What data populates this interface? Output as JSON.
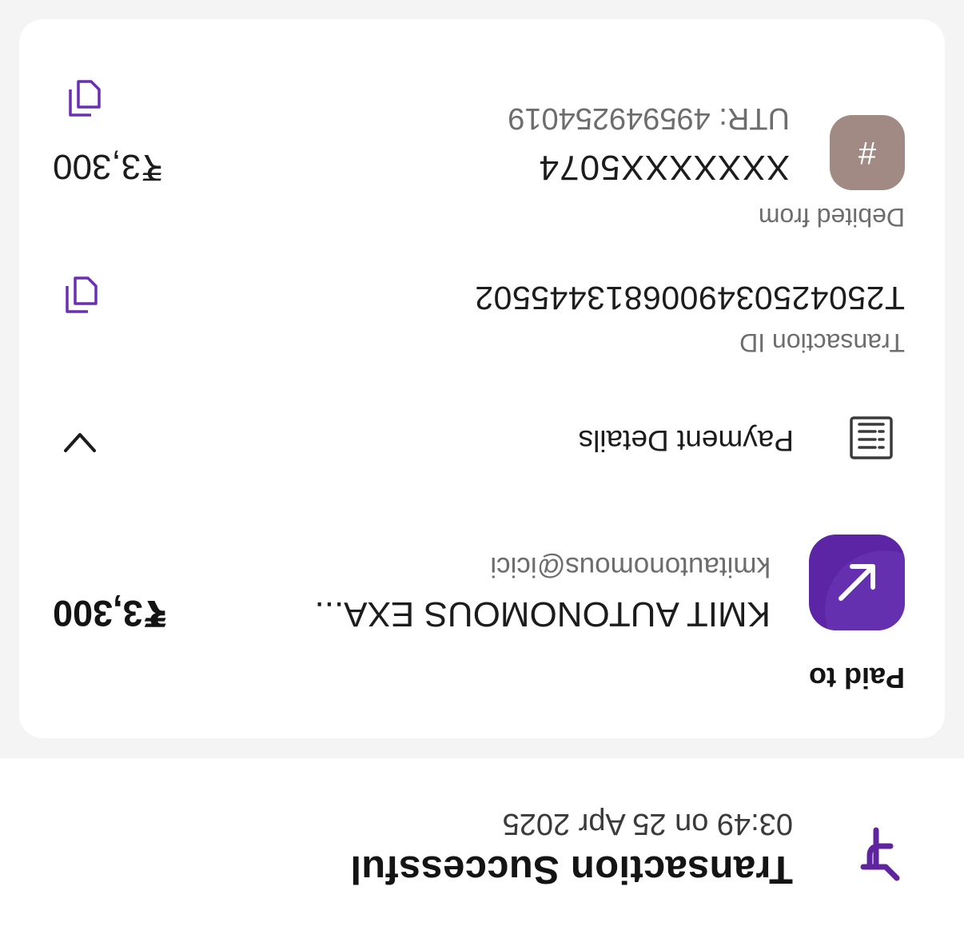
{
  "header": {
    "title": "Transaction Successful",
    "timestamp": "03:49 on 25 Apr 2025",
    "app_icon": "phonepe-logo-icon",
    "brand_color": "#5f259f"
  },
  "paid_to": {
    "label": "Paid to",
    "payee_name": "KMIT AUTONOMOUS EXA...",
    "payee_upi": "kmitautonomous@icici",
    "amount": "₹3,300",
    "avatar_icon": "arrow-down-left-icon"
  },
  "payment_details": {
    "label": "Payment Details",
    "icon": "receipt-icon",
    "toggle_icon": "chevron-up-icon",
    "transaction_id_label": "Transaction ID",
    "transaction_id": "T2504250349006813445502",
    "debited_from_label": "Debited from",
    "bank_avatar_symbol": "#",
    "account": "XXXXXXX5074",
    "utr": "UTR: 495949254019",
    "debited_amount": "₹3,300"
  }
}
